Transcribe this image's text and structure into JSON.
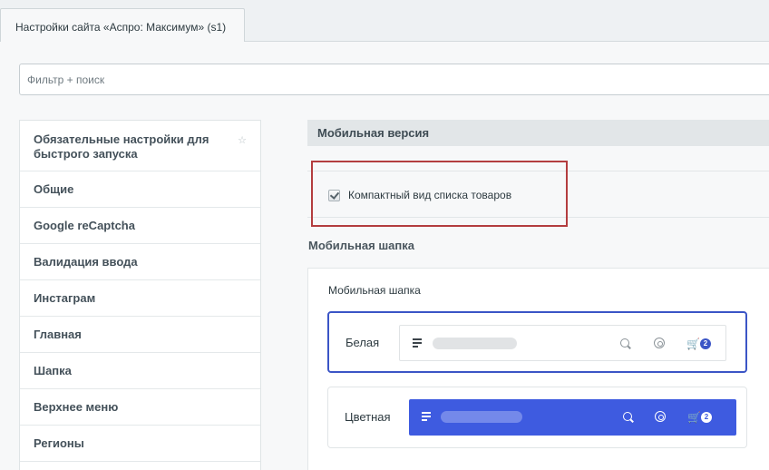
{
  "tab": {
    "title": "Настройки сайта «Аспро: Максимум» (s1)"
  },
  "filter": {
    "placeholder": "Фильтр + поиск"
  },
  "sidebar": {
    "items": [
      {
        "label": "Обязательные настройки для быстрого запуска",
        "starred": true
      },
      {
        "label": "Общие"
      },
      {
        "label": "Google reCaptcha"
      },
      {
        "label": "Валидация ввода"
      },
      {
        "label": "Инстаграм"
      },
      {
        "label": "Главная"
      },
      {
        "label": "Шапка"
      },
      {
        "label": "Верхнее меню"
      },
      {
        "label": "Регионы"
      }
    ],
    "star_glyph": "☆"
  },
  "mobile_section": {
    "title": "Мобильная версия",
    "compact_checkbox": {
      "label": "Компактный вид списка товаров",
      "checked": true
    }
  },
  "mobile_header": {
    "section_title": "Мобильная шапка",
    "field_title": "Мобильная шапка",
    "options": [
      {
        "label": "Белая",
        "selected": true,
        "cart_count": "2"
      },
      {
        "label": "Цветная",
        "selected": false,
        "cart_count": "2"
      }
    ]
  },
  "colors": {
    "accent": "#3b55c6",
    "color_header_bg": "#3e5be0",
    "highlight_border": "#b33d3f"
  },
  "icons": {
    "menu": "menu-icon",
    "search": "search-icon",
    "user": "user-icon",
    "cart": "cart-icon"
  }
}
